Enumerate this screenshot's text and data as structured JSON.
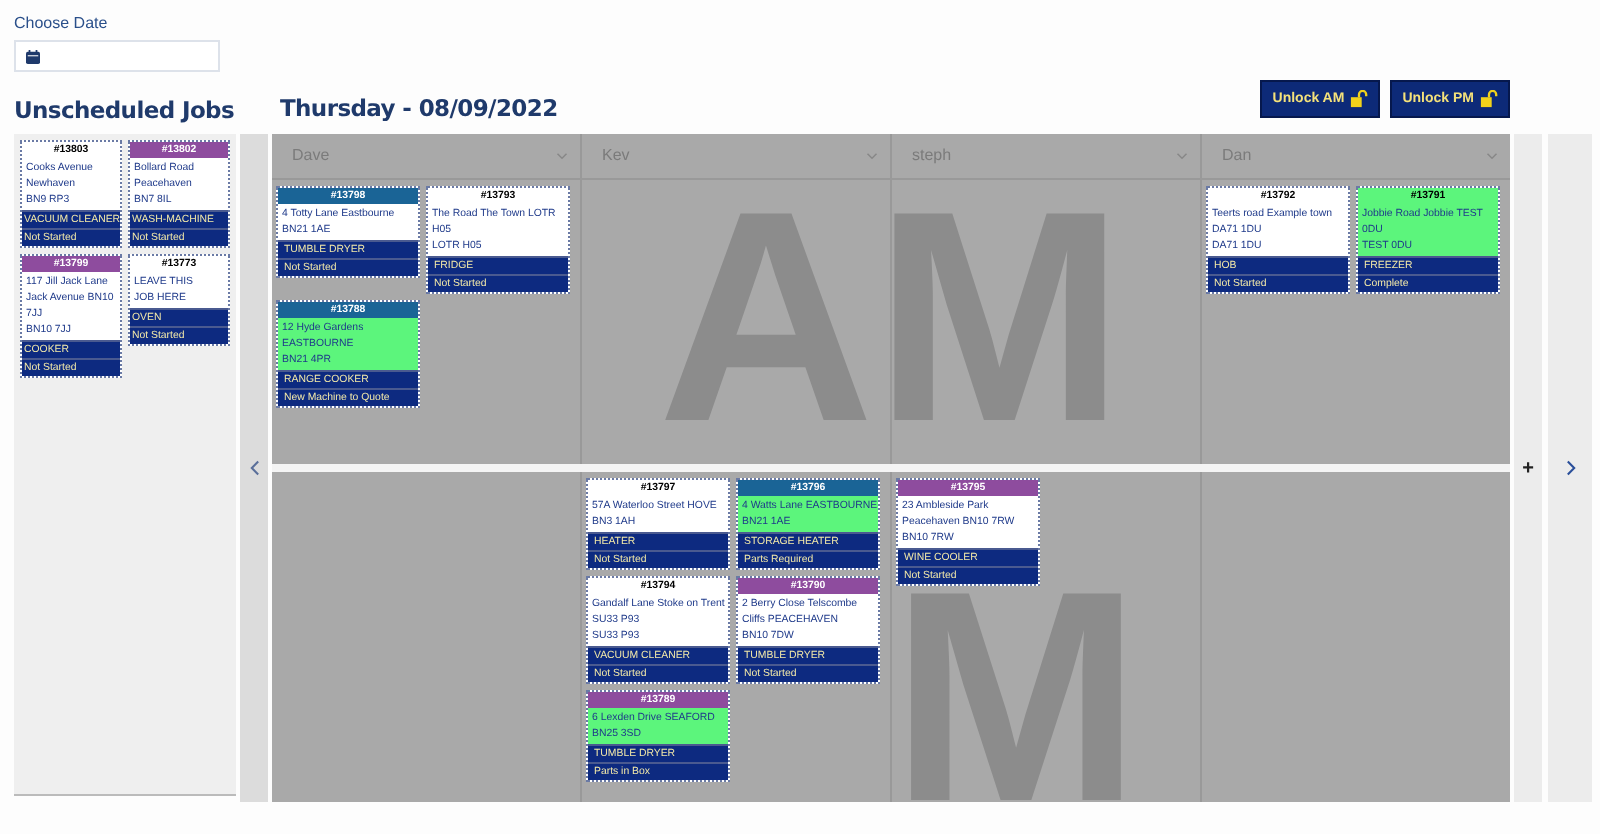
{
  "date_picker": {
    "label": "Choose Date"
  },
  "unscheduled": {
    "title": "Unscheduled Jobs",
    "jobs": [
      {
        "number": "#13803",
        "color": "#ffffff",
        "highlighted": false,
        "address": [
          "Cooks Avenue",
          "Newhaven",
          "BN9 RP3"
        ],
        "appliance": "VACUUM CLEANER",
        "status": "Not Started"
      },
      {
        "number": "#13802",
        "color": "#8e4c9e",
        "highlighted": false,
        "address": [
          "Bollard Road",
          "Peacehaven",
          "BN7 8IL"
        ],
        "appliance": "WASH-MACHINE",
        "status": "Not Started"
      },
      {
        "number": "#13799",
        "color": "#8e4c9e",
        "highlighted": false,
        "address": [
          "117 Jill Jack Lane",
          "Jack Avenue BN10",
          "7JJ",
          "BN10 7JJ"
        ],
        "appliance": "COOKER",
        "status": "Not Started"
      },
      {
        "number": "#13773",
        "color": "#ffffff",
        "highlighted": false,
        "address": [
          "LEAVE THIS",
          "JOB HERE"
        ],
        "appliance": "OVEN",
        "status": "Not Started"
      }
    ]
  },
  "board": {
    "title": "Thursday - 08/09/2022",
    "buttons": [
      "Unlock AM",
      "Unlock PM"
    ],
    "engineers": [
      {
        "name": "Dave"
      },
      {
        "name": "Kev"
      },
      {
        "name": "steph"
      },
      {
        "name": "Dan"
      }
    ],
    "sessions": [
      {
        "label": "AM",
        "columns": [
          [
            {
              "number": "#13798",
              "color": "#1a6496",
              "highlighted": false,
              "address": [
                "4 Totty Lane Eastbourne",
                "BN21 1AE"
              ],
              "appliance": "TUMBLE DRYER",
              "status": "Not Started"
            },
            {
              "number": "#13793",
              "color": "#ffffff",
              "highlighted": false,
              "address": [
                "The Road The Town LOTR",
                "H05",
                "LOTR H05"
              ],
              "appliance": "FRIDGE",
              "status": "Not Started"
            },
            {
              "number": "#13788",
              "color": "#1a6496",
              "highlighted": true,
              "address": [
                "12 Hyde Gardens",
                "EASTBOURNE",
                "BN21 4PR"
              ],
              "appliance": "RANGE COOKER",
              "status": "New Machine to Quote"
            }
          ],
          [],
          [],
          [
            {
              "number": "#13792",
              "color": "#ffffff",
              "highlighted": false,
              "address": [
                "Teerts road Example town",
                "DA71 1DU",
                "DA71 1DU"
              ],
              "appliance": "HOB",
              "status": "Not Started"
            },
            {
              "number": "#13791",
              "color": "#5cf57c",
              "highlighted": true,
              "address": [
                "Jobbie Road Jobbie TEST",
                "0DU",
                "TEST 0DU"
              ],
              "appliance": "FREEZER",
              "status": "Complete"
            }
          ]
        ]
      },
      {
        "label": "M",
        "columns": [
          [],
          [
            {
              "number": "#13797",
              "color": "#ffffff",
              "highlighted": false,
              "address": [
                "57A Waterloo Street HOVE",
                "BN3 1AH"
              ],
              "appliance": "HEATER",
              "status": "Not Started"
            },
            {
              "number": "#13796",
              "color": "#1a6496",
              "highlighted": true,
              "address": [
                "4 Watts Lane EASTBOURNE",
                "BN21 1AE"
              ],
              "appliance": "STORAGE HEATER",
              "status": "Parts Required"
            },
            {
              "number": "#13794",
              "color": "#ffffff",
              "highlighted": false,
              "address": [
                "Gandalf Lane Stoke on Trent",
                "SU33 P93",
                "SU33 P93"
              ],
              "appliance": "VACUUM CLEANER",
              "status": "Not Started"
            },
            {
              "number": "#13790",
              "color": "#8e4c9e",
              "highlighted": false,
              "address": [
                "2 Berry Close Telscombe",
                "Cliffs PEACEHAVEN",
                "BN10 7DW"
              ],
              "appliance": "TUMBLE DRYER",
              "status": "Not Started"
            },
            {
              "number": "#13789",
              "color": "#8e4c9e",
              "highlighted": true,
              "address": [
                "6 Lexden Drive SEAFORD",
                "BN25 3SD"
              ],
              "appliance": "TUMBLE DRYER",
              "status": "Parts in Box"
            }
          ],
          [
            {
              "number": "#13795",
              "color": "#8e4c9e",
              "highlighted": false,
              "address": [
                "23 Ambleside Park",
                "Peacehaven BN10 7RW",
                "BN10 7RW"
              ],
              "appliance": "WINE COOLER",
              "status": "Not Started"
            }
          ],
          []
        ]
      }
    ]
  },
  "add_label": "+"
}
